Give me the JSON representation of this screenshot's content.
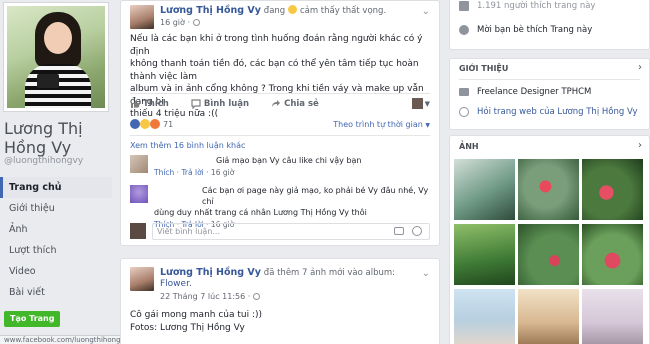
{
  "profile": {
    "name": "Lương Thị Hồng Vy",
    "name_line1": "Lương Thị",
    "name_line2": "Hồng Vy",
    "handle": "@luongthihongvy",
    "nav": [
      "Trang chủ",
      "Giới thiệu",
      "Ảnh",
      "Lượt thích",
      "Video",
      "Bài viết"
    ],
    "create_page": "Tạo Trang",
    "status_url": "www.facebook.com/luongthihongvy?pnref=story#"
  },
  "post1": {
    "author": "Lương Thị Hồng Vy",
    "feeling_prefix": "đang",
    "feeling": "cảm thấy thất vọng.",
    "time": "16 giờ",
    "text": [
      "Nếu là các bạn khi ở trong tình huống đoán rằng người khác có ý định",
      "không thanh toán tiền đó, các bạn có thể yên tâm tiếp tục hoàn thành việc làm",
      "album và in ảnh cổng không ? Trong khi tiền váy và make up vẫn đang bị",
      "thiếu 4 triệu nữa :(("
    ],
    "actions": {
      "like": "Thích",
      "comment": "Bình luận",
      "share": "Chia sẻ"
    },
    "reactions_count": "71",
    "sort_label": "Theo trình tự thời gian",
    "more_comments": "Xem thêm 16 bình luận khác",
    "comments": [
      {
        "text": "Giả mạo bạn Vy câu like chi vậy bạn",
        "like": "Thích",
        "reply": "Trả lời",
        "time": "16 giờ"
      },
      {
        "text_line1": "Các bạn ơi page này giả mạo, ko phải bé Vy đâu nhé, Vy chỉ",
        "text_line2": "dùng duy nhất trang cá nhân Lương Thị Hồng Vy thôi",
        "like": "Thích",
        "reply": "Trả lời",
        "time": "16 giờ"
      }
    ],
    "comment_placeholder": "Viết bình luận..."
  },
  "post2": {
    "author": "Lương Thị Hồng Vy",
    "action": "đã thêm 7 ảnh mới vào album:",
    "album": "Flower.",
    "time": "22 Tháng 7 lúc 11:56",
    "text_line1": "Cô gái mong manh của tui :))",
    "text_line2": "Fotos: Lương Thị Hồng Vy"
  },
  "right": {
    "likes_line": "1.191 người thích trang này",
    "invite": "Mời bạn bè thích Trang này",
    "intro_title": "GIỚI THIỆU",
    "job": "Freelance Designer TPHCM",
    "site_link": "Hỏi trang web của Lương Thị Hồng Vy",
    "photos_title": "ẢNH"
  },
  "colors": {
    "brand": "#4267b2",
    "link": "#365899",
    "create_green": "#42b72a"
  }
}
